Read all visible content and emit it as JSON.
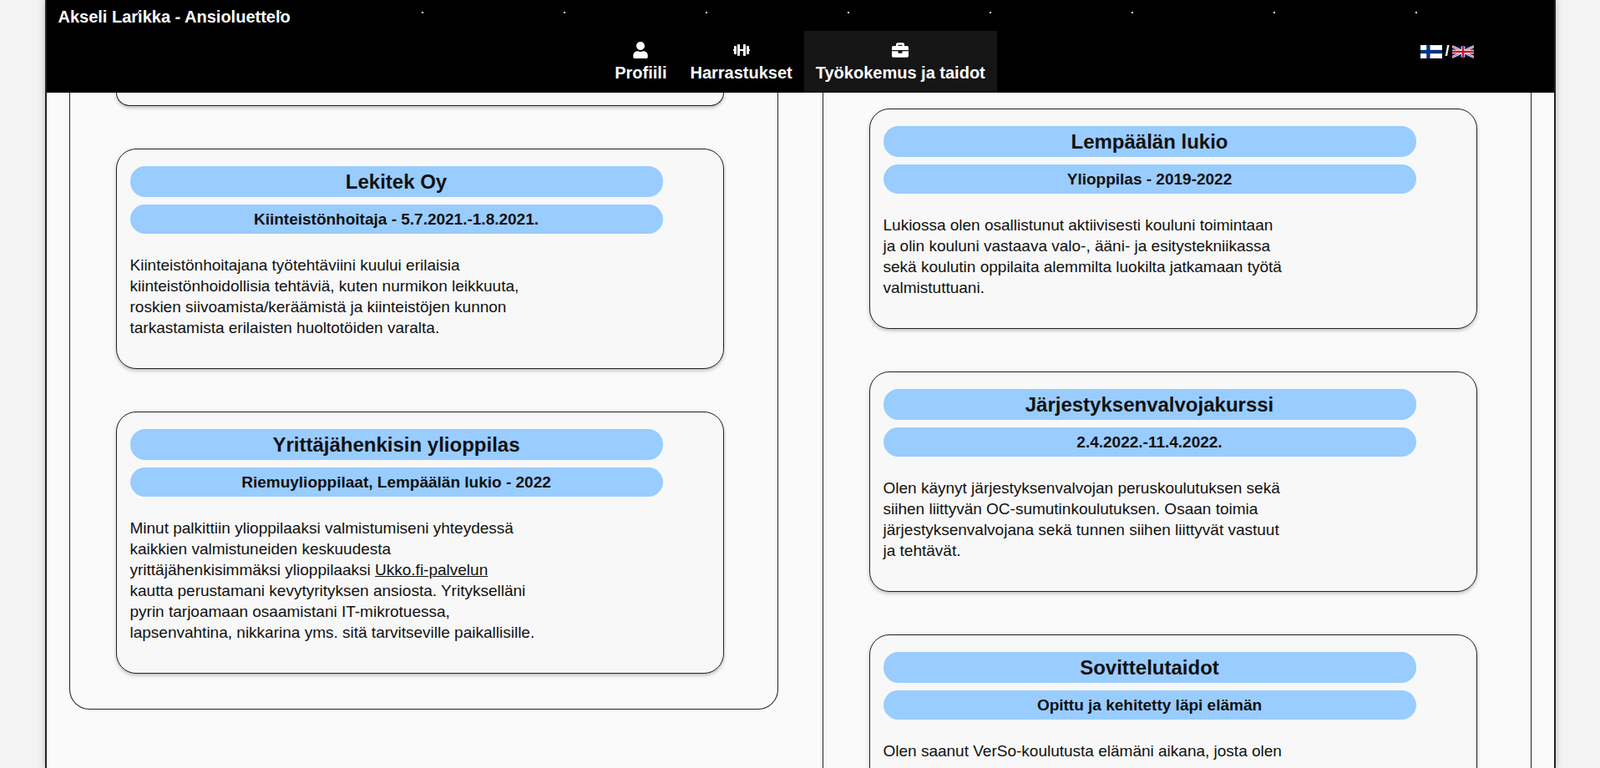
{
  "window": {
    "title": "Akseli Larikka - Ansioluettelo"
  },
  "language_switch": {
    "separator": "/"
  },
  "nav": [
    {
      "label": "Profiili",
      "selected": false
    },
    {
      "label": "Harrastukset",
      "selected": false
    },
    {
      "label": "Työkokemus ja taidot",
      "selected": true
    }
  ],
  "columns": [
    {
      "cut_card_above": true,
      "cards": [
        {
          "title": "Lekitek Oy",
          "subtitle": "Kiinteistönhoitaja - 5.7.2021.-1.8.2021.",
          "lines": [
            "Kiinteistönhoitajana työtehtäviini kuului erilaisia",
            "kiinteistönhoidollisia tehtäviä, kuten nurmikon leikkuuta,",
            "roskien siivoamista/keräämistä ja kiinteistöjen kunnon",
            "tarkastamista erilaisten huoltotöiden varalta."
          ]
        },
        {
          "title": "Yrittäjähenkisin ylioppilas",
          "subtitle": "Riemuylioppilaat, Lempäälän lukio - 2022",
          "lines": [
            "Minut palkittiin ylioppilaaksi valmistumiseni yhteydessä",
            "kaikkien valmistuneiden keskuudesta",
            [
              {
                "text": "yrittäjähenkisimmäksi ylioppilaaksi ",
                "link": false
              },
              {
                "text": "Ukko.fi-palvelun",
                "link": true
              }
            ],
            "kautta perustamani kevytyrityksen ansiosta. Yritykselläni",
            "pyrin tarjoamaan osaamistani IT-mikrotuessa,",
            "lapsenvahtina, nikkarina yms. sitä tarvitseville paikallisille."
          ]
        }
      ]
    },
    {
      "cut_card_above": false,
      "cards": [
        {
          "title": "Lempäälän lukio",
          "subtitle": "Ylioppilas - 2019-2022",
          "lines": [
            "Lukiossa olen osallistunut aktiivisesti kouluni toimintaan",
            "ja olin kouluni vastaava valo-, ääni- ja esitystekniikassa",
            "sekä koulutin oppilaita alemmilta luokilta jatkamaan työtä",
            "valmistuttuani."
          ]
        },
        {
          "title": "Järjestyksenvalvojakurssi",
          "subtitle": "2.4.2022.-11.4.2022.",
          "lines": [
            "Olen käynyt järjestyksenvalvojan peruskoulutuksen sekä",
            "siihen liittyvän OC-sumutinkoulutuksen. Osaan toimia",
            "järjestyksenvalvojana sekä tunnen siihen liittyvät vastuut",
            "ja tehtävät."
          ]
        },
        {
          "title": "Sovittelutaidot",
          "subtitle": "Opittu ja kehitetty läpi elämän",
          "lines": [
            "Olen saanut VerSo-koulutusta elämäni aikana, josta olen"
          ]
        }
      ]
    }
  ]
}
